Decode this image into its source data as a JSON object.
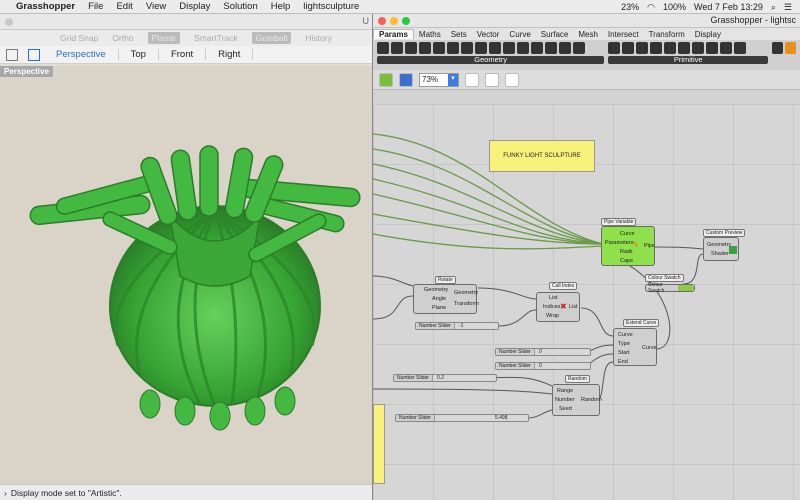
{
  "menubar": {
    "items": [
      "Grasshopper",
      "File",
      "Edit",
      "View",
      "Display",
      "Solution",
      "Help",
      "lightsculpture"
    ],
    "battery_left": "23%",
    "battery_right": "100%",
    "clock": "Wed 7 Feb  13:29"
  },
  "rhino": {
    "toolbar": [
      "Grid Snap",
      "Ortho",
      "Planar",
      "SmartTrack",
      "Gumball",
      "History"
    ],
    "view_tabs": [
      "Perspective",
      "Top",
      "Front",
      "Right"
    ],
    "viewport_label": "Perspective",
    "status": "Display mode set to \"Artistic\"."
  },
  "gh": {
    "title": "Grasshopper - lightsc",
    "tabs": [
      "Params",
      "Maths",
      "Sets",
      "Vector",
      "Curve",
      "Surface",
      "Mesh",
      "Intersect",
      "Transform",
      "Display"
    ],
    "ribbon_groups": [
      "Geometry",
      "Primitive"
    ],
    "zoom": "73%",
    "nodes": {
      "panel_text": "FUNKY LIGHT SCULPTURE",
      "pipe_title": "Pipe Variable",
      "pipe_inputs": [
        "Curve",
        "Parameters",
        "Radii",
        "Caps"
      ],
      "pipe_output": "Pipe",
      "preview_title": "Custom Preview",
      "preview_inputs": [
        "Geometry",
        "Shader"
      ],
      "swatch_title": "Colour Swatch",
      "swatch_label": "Colour Swatch",
      "rotate_title": "Rotate",
      "rotate_inputs": [
        "Geometry",
        "Angle",
        "Plane"
      ],
      "rotate_outputs": [
        "Geometry",
        "Transform"
      ],
      "cull_title": "Cull Index",
      "cull_inputs": [
        "List",
        "Indices",
        "Wrap"
      ],
      "cull_output": "List",
      "extend_title": "Extend Curve",
      "extend_inputs": [
        "Curve",
        "Type",
        "Start",
        "End"
      ],
      "extend_output": "Curve",
      "random_title": "Random",
      "random_inputs": [
        "Range",
        "Number",
        "Seed"
      ],
      "random_output": "Random",
      "sliders": [
        {
          "name": "Number Slider",
          "value": "-1"
        },
        {
          "name": "Number Slider",
          "value": "0"
        },
        {
          "name": "Number Slider",
          "value": "0"
        },
        {
          "name": "Number Slider",
          "value": "0.2"
        },
        {
          "name": "Number Slider",
          "value": "5.498"
        }
      ]
    }
  },
  "colors": {
    "sculpture": "#1aa31a",
    "node_green": "#8fe04a",
    "panel_yellow": "#f8f27c"
  }
}
